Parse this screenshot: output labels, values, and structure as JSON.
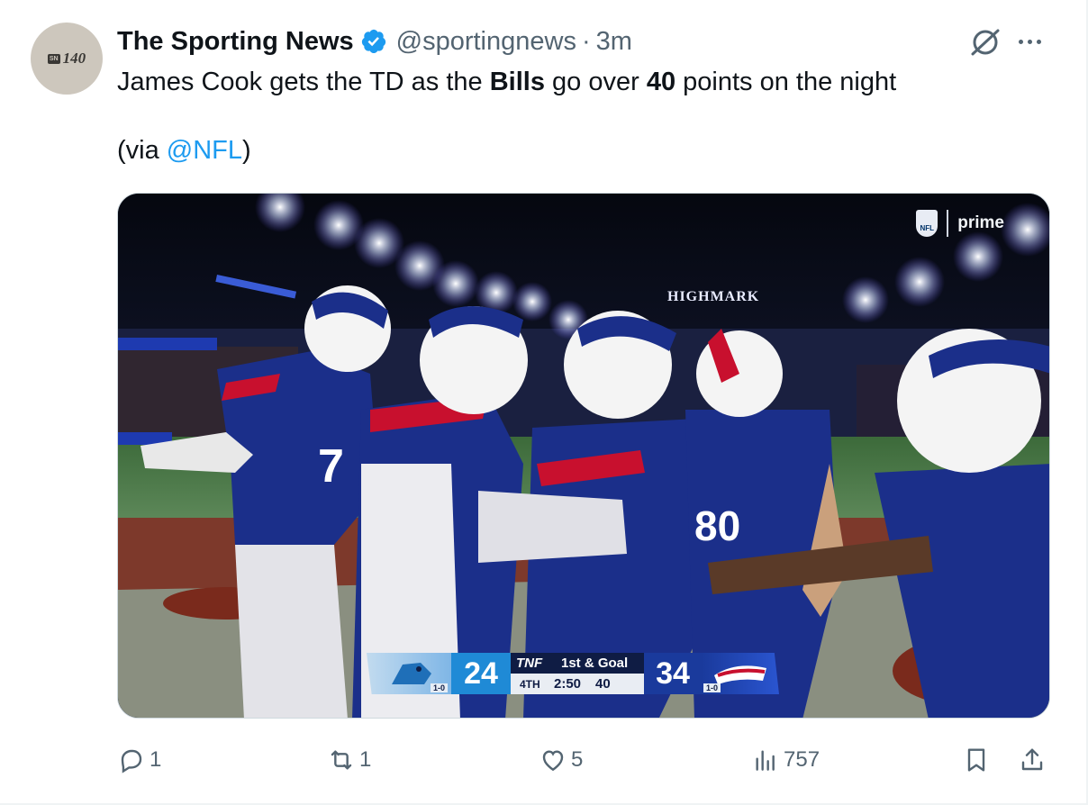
{
  "author": {
    "name": "The Sporting News",
    "handle": "@sportingnews",
    "separator": "·",
    "time": "3m",
    "avatar": {
      "badge": "SN",
      "number": "140",
      "background": "#cdc7bd"
    },
    "verified_color": "#1d9bf0"
  },
  "tweet": {
    "line1": {
      "p1": "James Cook gets the TD as the ",
      "b1": "Bills",
      "p2": " go over ",
      "b2": "40",
      "p3": " points on the night"
    },
    "line2": {
      "p1": "(via ",
      "mention": "@NFL",
      "p2": ")"
    }
  },
  "media": {
    "watermark": "prime",
    "nfl_shield": "NFL",
    "stadium_sign": "HIGHMARK",
    "scorebug": {
      "away_score": "24",
      "away_record": "1-0",
      "broadcast": "TNF",
      "down": "1st & Goal",
      "quarter": "4TH",
      "clock": "2:50",
      "play_clock": "40",
      "home_score": "34",
      "home_record": "1-0"
    },
    "jersey_numbers": [
      "7",
      "80"
    ]
  },
  "actions": {
    "replies": "1",
    "reposts": "1",
    "likes": "5",
    "views": "757"
  },
  "colors": {
    "text": "#0f1419",
    "muted": "#536471",
    "link": "#1d9bf0",
    "bills_blue": "#1a3a9c",
    "bills_red": "#c8102e"
  },
  "icons": [
    "grok-icon",
    "more-icon",
    "reply-icon",
    "repost-icon",
    "like-icon",
    "views-icon",
    "bookmark-icon",
    "share-icon",
    "verified-icon"
  ]
}
